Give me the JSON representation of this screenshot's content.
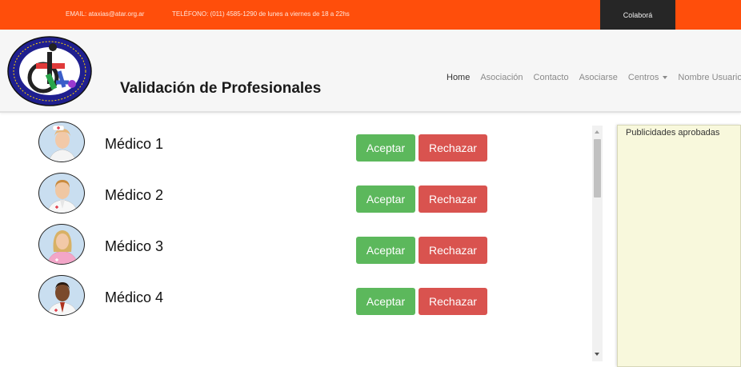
{
  "topbar": {
    "email": "EMAIL: ataxias@atar.org.ar",
    "phone": "TELÉFONO: (011) 4585-1290 de lunes a viernes de 18 a 22hs",
    "colabora": "Colaborá",
    "bg_color": "#ff4e0b"
  },
  "header": {
    "logo_text": "Asociación Civil de ATaxias de ARgentina",
    "title": "Validación de Profesionales",
    "nav": [
      {
        "label": "Home"
      },
      {
        "label": "Asociación"
      },
      {
        "label": "Contacto"
      },
      {
        "label": "Asociarse"
      },
      {
        "label": "Centros"
      },
      {
        "label": "Nombre Usuario"
      }
    ]
  },
  "doctors": [
    {
      "name": "Médico 1",
      "avatar": "female-nurse-avatar",
      "accept": "Aceptar",
      "reject": "Rechazar"
    },
    {
      "name": "Médico 2",
      "avatar": "male-doctor-avatar",
      "accept": "Aceptar",
      "reject": "Rechazar"
    },
    {
      "name": "Médico 3",
      "avatar": "female-doctor-avatar",
      "accept": "Aceptar",
      "reject": "Rechazar"
    },
    {
      "name": "Médico 4",
      "avatar": "male-doctor-dark-avatar",
      "accept": "Aceptar",
      "reject": "Rechazar"
    }
  ],
  "ads": {
    "title": "Publicidades aprobadas"
  },
  "colors": {
    "accept": "#5cb85c",
    "reject": "#d9534f",
    "ads_bg": "#f8f8dc"
  }
}
